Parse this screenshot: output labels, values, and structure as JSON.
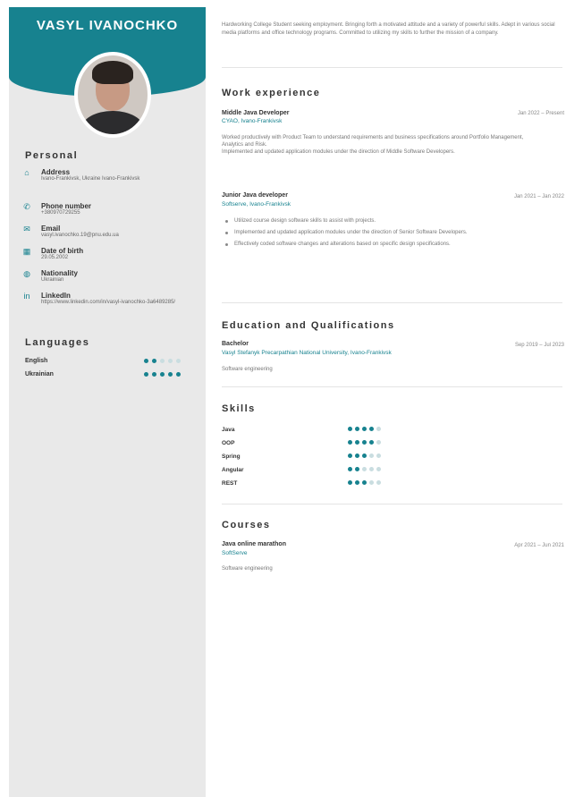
{
  "sidebar": {
    "name": "VASYL IVANOCHKO",
    "personal_heading": "Personal",
    "personal_items": [
      {
        "icon": "home-icon",
        "glyph": "⌂",
        "label": "Address",
        "value": "Ivano-Frankivsk, Ukraine Ivano-Frankivsk"
      },
      {
        "icon": "phone-icon",
        "glyph": "✆",
        "label": "Phone number",
        "value": "+380970729255"
      },
      {
        "icon": "email-icon",
        "glyph": "✉",
        "label": "Email",
        "value": "vasyl.ivanochko.19@pnu.edu.ua"
      },
      {
        "icon": "calendar-icon",
        "glyph": "▦",
        "label": "Date of birth",
        "value": "29.05.2002"
      },
      {
        "icon": "globe-icon",
        "glyph": "◍",
        "label": "Nationality",
        "value": "Ukrainian"
      },
      {
        "icon": "linkedin-icon",
        "glyph": "in",
        "label": "LinkedIn",
        "value": "https://www.linkedin.com/in/vasyl-ivanochko-3a6489285/"
      }
    ],
    "languages_heading": "Languages",
    "languages": [
      {
        "name": "English",
        "level": 2,
        "max": 5
      },
      {
        "name": "Ukrainian",
        "level": 5,
        "max": 5
      }
    ]
  },
  "main": {
    "summary": "Hardworking College Student seeking employment. Bringing forth a motivated attitude and a variety of powerful skills. Adept in various social media platforms and office technology programs. Committed to utilizing my skills to further the mission of a company.",
    "work_heading": "Work experience",
    "jobs": [
      {
        "title": "Middle Java Developer",
        "company": "CYAO, Ivano-Frankivsk",
        "dates": "Jan 2022 – Present",
        "description": "Worked productively with Product Team to understand requirements and business specifications around Portfolio Management, Analytics and Risk.\nImplemented and updated application modules under the direction of Middle Software Developers."
      },
      {
        "title": "Junior Java developer",
        "company": "Softserve, Ivano-Frankivsk",
        "dates": "Jan 2021 – Jan 2022",
        "bullets": [
          "Utilized course design software skills to assist with projects.",
          "Implemented and updated application modules under the direction of Senior Software Developers.",
          "Effectively coded software changes and alterations based on specific design specifications."
        ]
      }
    ],
    "education_heading": "Education and Qualifications",
    "education": {
      "degree": "Bachelor",
      "school": "Vasyl Stefanyk Precarpathian National University, Ivano-Frankivsk",
      "dates": "Sep 2019 – Jul 2023",
      "field": "Software engineering"
    },
    "skills_heading": "Skills",
    "skills": [
      {
        "name": "Java",
        "level": 4,
        "max": 5
      },
      {
        "name": "OOP",
        "level": 4,
        "max": 5
      },
      {
        "name": "Spring",
        "level": 3,
        "max": 5
      },
      {
        "name": "Angular",
        "level": 2,
        "max": 5
      },
      {
        "name": "REST",
        "level": 3,
        "max": 5
      }
    ],
    "courses_heading": "Courses",
    "course": {
      "title": "Java online marathon",
      "provider": "SoftServe",
      "dates": "Apr 2021 – Jun 2021",
      "field": "Software engineering"
    }
  },
  "colors": {
    "accent": "#17828f",
    "sidebar_bg": "#e9e9e9"
  }
}
